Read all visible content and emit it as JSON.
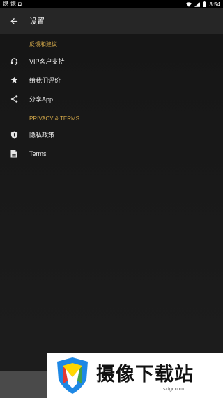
{
  "status_bar": {
    "left_glyphs": [
      "熄",
      "熄",
      "◘"
    ],
    "time": "3:54"
  },
  "app_bar": {
    "title": "设置",
    "back_icon": "arrow-left-icon"
  },
  "sections": [
    {
      "header": "反馈和建议",
      "items": [
        {
          "label": "VIP客户支持",
          "icon": "headset-icon"
        },
        {
          "label": "给我们评价",
          "icon": "star-icon"
        },
        {
          "label": "分享App",
          "icon": "share-icon"
        }
      ]
    },
    {
      "header": "PRIVACY & TERMS",
      "items": [
        {
          "label": "隐私政策",
          "icon": "shield-icon"
        },
        {
          "label": "Terms",
          "icon": "document-icon"
        }
      ]
    }
  ],
  "watermark": {
    "title": "摄像下载站",
    "subtitle": "sxtgr.com"
  },
  "colors": {
    "accent": "#d4a94a",
    "background": "#1a1a1a",
    "app_bar": "#262626"
  }
}
